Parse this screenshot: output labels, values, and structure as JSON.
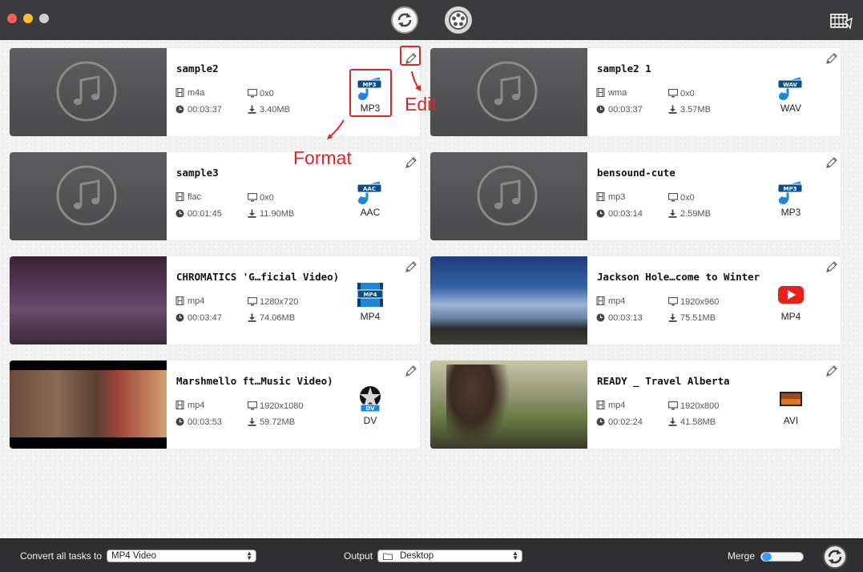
{
  "toolbar": {
    "convert_tab": "convert-tab",
    "media_tab": "media-tab",
    "toolbox": "toolbox"
  },
  "items": [
    {
      "title": "sample2",
      "format_src": "m4a",
      "resolution": "0x0",
      "duration": "00:03:37",
      "size": "3.40MB",
      "target_badge": "MP3",
      "target": "MP3",
      "thumb": "audio"
    },
    {
      "title": "sample2 1",
      "format_src": "wma",
      "resolution": "0x0",
      "duration": "00:03:37",
      "size": "3.57MB",
      "target_badge": "WAV",
      "target": "WAV",
      "thumb": "audio"
    },
    {
      "title": "sample3",
      "format_src": "flac",
      "resolution": "0x0",
      "duration": "00:01:45",
      "size": "11.90MB",
      "target_badge": "AAC",
      "target": "AAC",
      "thumb": "audio"
    },
    {
      "title": "bensound-cute",
      "format_src": "mp3",
      "resolution": "0x0",
      "duration": "00:03:14",
      "size": "2.59MB",
      "target_badge": "MP3",
      "target": "MP3",
      "thumb": "audio"
    },
    {
      "title": "CHROMATICS 'G…ficial Video)",
      "format_src": "mp4",
      "resolution": "1280x720",
      "duration": "00:03:47",
      "size": "74.06MB",
      "target_badge": "MP4",
      "target": "MP4",
      "thumb": "v-purple"
    },
    {
      "title": "Jackson Hole…come to Winter",
      "format_src": "mp4",
      "resolution": "1920x960",
      "duration": "00:03:13",
      "size": "75.51MB",
      "target_badge": "",
      "target": "MP4",
      "thumb": "v-sky"
    },
    {
      "title": "Marshmello ft…Music Video)",
      "format_src": "mp4",
      "resolution": "1920x1080",
      "duration": "00:03:53",
      "size": "59.72MB",
      "target_badge": "DV",
      "target": "DV",
      "thumb": "v-dark"
    },
    {
      "title": "READY _ Travel Alberta",
      "format_src": "mp4",
      "resolution": "1920x800",
      "duration": "00:02:24",
      "size": "41.58MB",
      "target_badge": "",
      "target": "AVI",
      "thumb": "v-field"
    }
  ],
  "annotations": {
    "edit": "Edit",
    "format": "Format"
  },
  "bottom": {
    "convert_all_label": "Convert all tasks to",
    "convert_all_value": "MP4 Video",
    "output_label": "Output",
    "output_value": "Desktop",
    "merge_label": "Merge"
  },
  "colors": {
    "annotation": "#e02424",
    "toggle_knob": "#3b9df0"
  }
}
